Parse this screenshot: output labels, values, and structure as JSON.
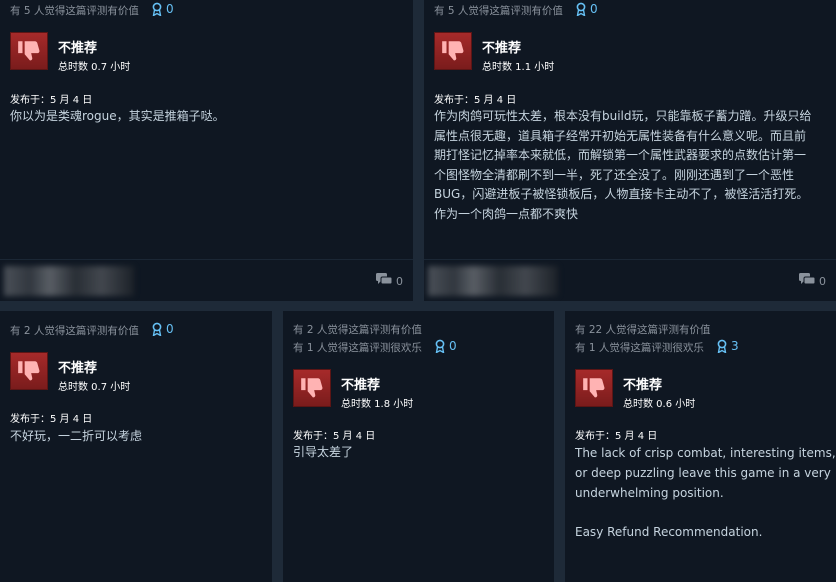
{
  "reviews": [
    {
      "helpful_text": "有 5 人觉得这篇评测有价值",
      "awards": "0",
      "verdict": "不推荐",
      "hours": "总时数 0.7 小时",
      "posted": "发布于：5 月 4 日",
      "body": [
        "你以为是类魂rogue，其实是推箱子哒。"
      ],
      "comments": "0"
    },
    {
      "helpful_text": "有 5 人觉得这篇评测有价值",
      "awards": "0",
      "verdict": "不推荐",
      "hours": "总时数 1.1 小时",
      "posted": "发布于：5 月 4 日",
      "body": [
        "作为肉鸽可玩性太差，根本没有build玩，只能靠板子蓄力蹭。升级只给",
        "属性点很无趣，道具箱子经常开初始无属性装备有什么意义呢。而且前",
        "期打怪记忆掉率本来就低，而解锁第一个属性武器要求的点数估计第一",
        "个图怪物全清都刷不到一半，死了还全没了。刚刚还遇到了一个恶性",
        "BUG，闪避进板子被怪锁板后，人物直接卡主动不了，被怪活活打死。",
        "作为一个肉鸽一点都不爽快"
      ],
      "comments": "0"
    },
    {
      "helpful_text": "有 2 人觉得这篇评测有价值",
      "awards": "0",
      "verdict": "不推荐",
      "hours": "总时数 0.7 小时",
      "posted": "发布于：5 月 4 日",
      "body": [
        "不好玩，一二折可以考虑"
      ]
    },
    {
      "helpful_text": "有 2 人觉得这篇评测有价值",
      "funny_text": "有 1 人觉得这篇评测很欢乐",
      "awards": "0",
      "verdict": "不推荐",
      "hours": "总时数 1.8 小时",
      "posted": "发布于：5 月 4 日",
      "body": [
        "引导太差了"
      ]
    },
    {
      "helpful_text": "有 22 人觉得这篇评测有价值",
      "funny_text": "有 1 人觉得这篇评测很欢乐",
      "awards": "3",
      "verdict": "不推荐",
      "hours": "总时数 0.6 小时",
      "posted": "发布于：5 月 4 日",
      "body": [
        "The lack of crisp combat, interesting items,",
        "or deep puzzling leave this game in a very",
        "underwhelming position.",
        "",
        "Easy Refund Recommendation."
      ]
    }
  ],
  "icons": {
    "thumbs_down": "thumbs-down-icon",
    "award": "award-icon",
    "comment": "comment-icon"
  },
  "colors": {
    "thumb_bg": "#a62a2a",
    "award": "#66c0f4",
    "card_bg": "#0f1722",
    "body_text": "#c6d4df"
  }
}
